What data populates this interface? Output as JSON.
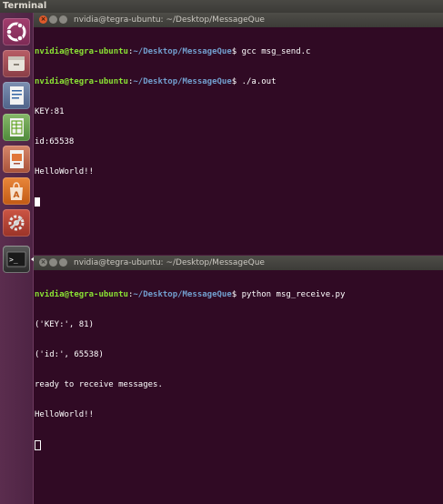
{
  "top_panel": {
    "title": "Terminal"
  },
  "launcher": {
    "items": [
      {
        "name": "dash",
        "icon": "ubuntu-logo-icon"
      },
      {
        "name": "files",
        "icon": "file-cabinet-icon"
      },
      {
        "name": "writer",
        "icon": "document-icon"
      },
      {
        "name": "calc",
        "icon": "spreadsheet-icon"
      },
      {
        "name": "impress",
        "icon": "presentation-icon"
      },
      {
        "name": "software-center",
        "icon": "shopping-bag-icon"
      },
      {
        "name": "system-settings",
        "icon": "gear-wrench-icon"
      },
      {
        "name": "terminal",
        "icon": "terminal-icon",
        "active": true
      }
    ]
  },
  "terminals": [
    {
      "title": "nvidia@tegra-ubuntu: ~/Desktop/MessageQue",
      "lines": [
        {
          "type": "prompt",
          "user": "nvidia@tegra-ubuntu",
          "sep": ":",
          "path": "~/Desktop/MessageQue",
          "sym": "$ ",
          "cmd": "gcc msg_send.c"
        },
        {
          "type": "prompt",
          "user": "nvidia@tegra-ubuntu",
          "sep": ":",
          "path": "~/Desktop/MessageQue",
          "sym": "$ ",
          "cmd": "./a.out"
        },
        {
          "type": "out",
          "text": "KEY:81"
        },
        {
          "type": "out",
          "text": "id:65538"
        },
        {
          "type": "out",
          "text": "HelloWorld!!"
        }
      ]
    },
    {
      "title": "nvidia@tegra-ubuntu: ~/Desktop/MessageQue",
      "lines": [
        {
          "type": "prompt",
          "user": "nvidia@tegra-ubuntu",
          "sep": ":",
          "path": "~/Desktop/MessageQue",
          "sym": "$ ",
          "cmd": "python msg_receive.py"
        },
        {
          "type": "out",
          "text": "('KEY:', 81)"
        },
        {
          "type": "out",
          "text": "('id:', 65538)"
        },
        {
          "type": "out",
          "text": "ready to receive messages."
        },
        {
          "type": "out",
          "text": "HelloWorld!!"
        }
      ]
    }
  ],
  "colors": {
    "terminal_bg": "#300a24",
    "prompt_user": "#8ae234",
    "prompt_path": "#729fcf",
    "desktop_bg": "#4a1c3c"
  }
}
